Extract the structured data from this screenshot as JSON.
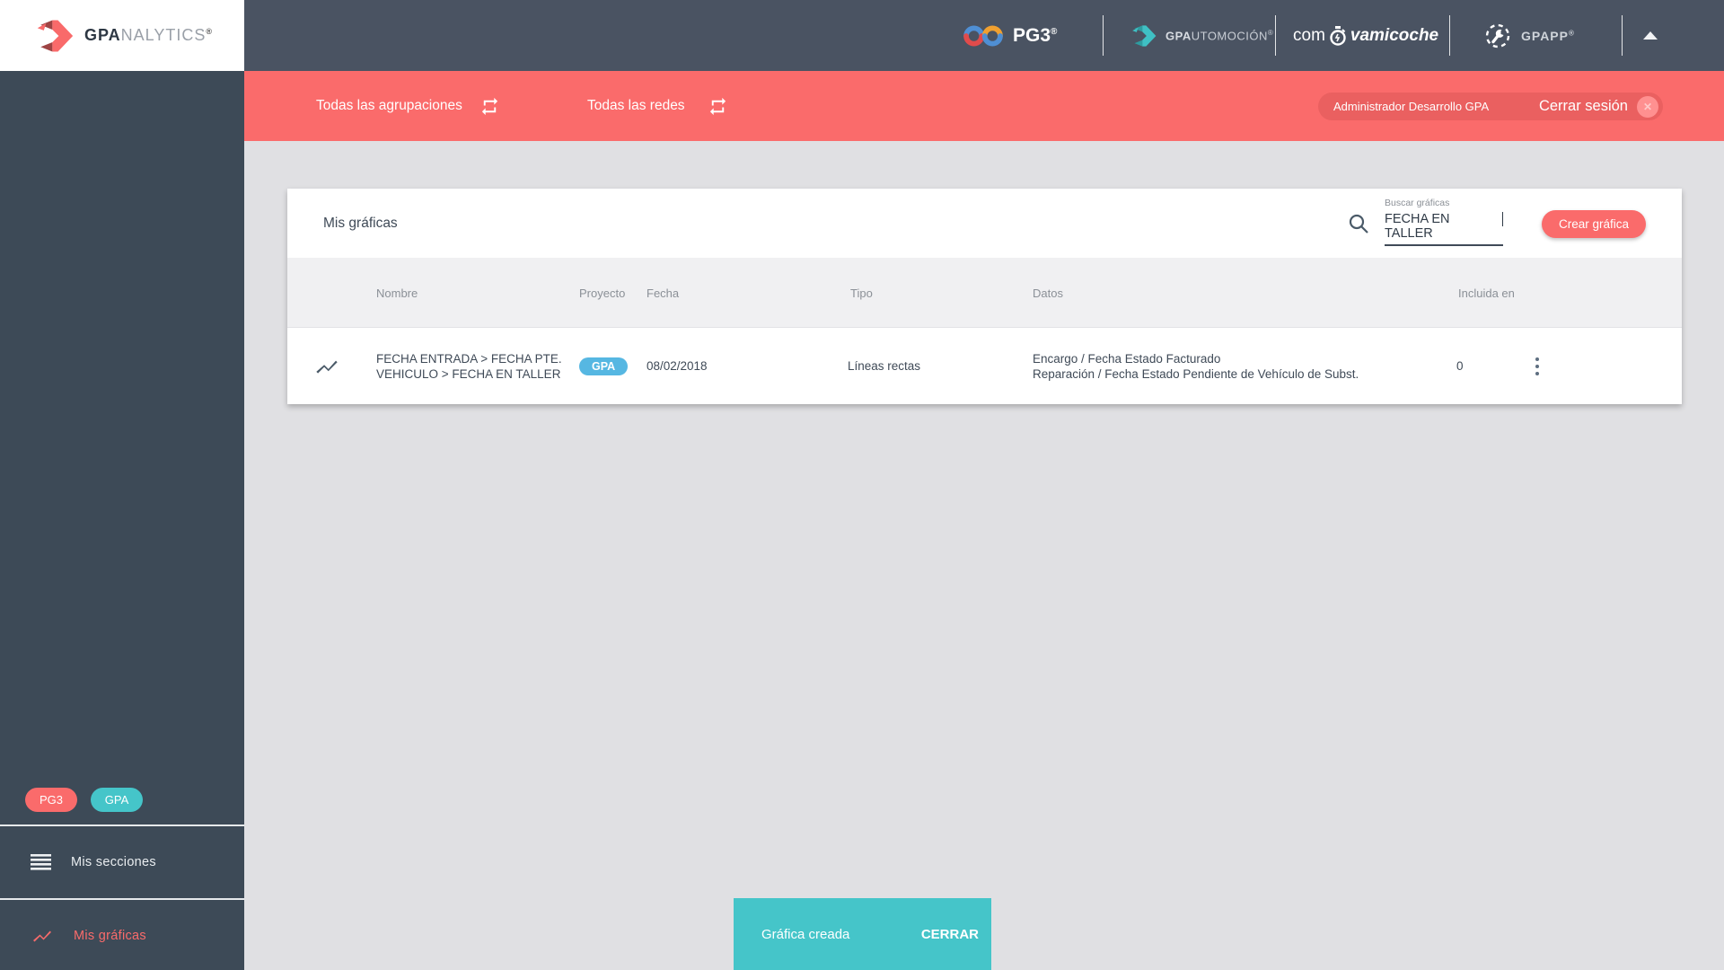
{
  "logo": {
    "bold": "GPA",
    "light": "NALYTICS",
    "reg": "®"
  },
  "topbar": {
    "pg3": {
      "label": "PG3",
      "reg": "®"
    },
    "gpautomocion": {
      "bold": "GPA",
      "rest": "UTOMOCIÓN",
      "reg": "®"
    },
    "comprovamicoche": {
      "pre": "com",
      "post": "vamicoche"
    },
    "gpapp": {
      "label": "GPAPP",
      "reg": "®"
    }
  },
  "filterbar": {
    "groupings": "Todas las agrupaciones",
    "networks": "Todas las redes",
    "user": "Administrador Desarrollo GPA",
    "logout": "Cerrar sesión",
    "close_x": "✕"
  },
  "card": {
    "title": "Mis gráficas",
    "search": {
      "label": "Buscar gráficas",
      "value": "FECHA EN TALLER"
    },
    "create_button": "Crear gráfica",
    "table": {
      "headers": {
        "name": "Nombre",
        "project": "Proyecto",
        "date": "Fecha",
        "type": "Tipo",
        "data": "Datos",
        "included": "Incluida en"
      },
      "rows": [
        {
          "name_line1": "FECHA ENTRADA > FECHA PTE.",
          "name_line2": "VEHICULO > FECHA EN TALLER",
          "project_badge": "GPA",
          "date": "08/02/2018",
          "type": "Líneas rectas",
          "data_line1": "Encargo / Fecha Estado Facturado",
          "data_line2": "Reparación / Fecha Estado Pendiente de Vehículo de Subst.",
          "included_in": "0"
        }
      ]
    }
  },
  "sidebar": {
    "badges": [
      {
        "label": "PG3"
      },
      {
        "label": "GPA"
      }
    ],
    "items": [
      {
        "label": "Mis secciones"
      },
      {
        "label": "Mis gráficas"
      }
    ]
  },
  "toast": {
    "message": "Gráfica creada",
    "action": "CERRAR"
  },
  "colors": {
    "accent_red": "#fa6b6b",
    "teal": "#45c5c9",
    "badge_blue": "#56b7e2",
    "topbar_bg": "#4a5362",
    "sidebar_bg": "#3d4a57",
    "page_bg": "#e0e0e3"
  }
}
